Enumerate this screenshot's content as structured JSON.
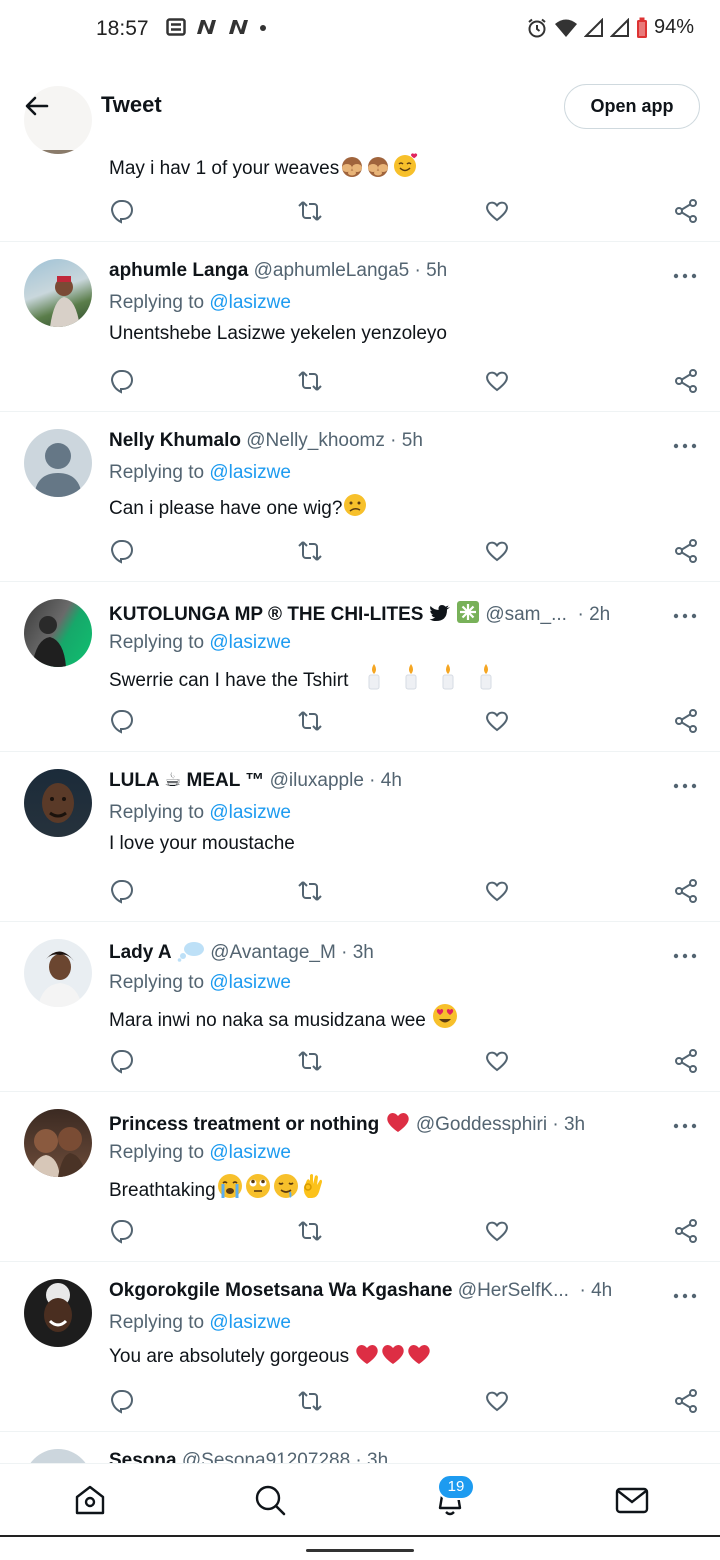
{
  "status_bar": {
    "time": "18:57",
    "battery_text": "94%",
    "notif_icons": [
      "news-icon",
      "n-app-icon",
      "n-app-icon",
      "dot"
    ]
  },
  "header": {
    "title": "Tweet",
    "open_app_label": "Open app"
  },
  "replying_to_prefix": "Replying to ",
  "partial_top": {
    "text": "May i hav 1 of your weaves"
  },
  "tweets": [
    {
      "name": "aphumle Langa",
      "handle": "@aphumleLanga5",
      "time": "5h",
      "replying_to": "@lasizwe",
      "text": "Unentshebe Lasizwe yekelen yenzoleyo"
    },
    {
      "name": "Nelly Khumalo",
      "handle": "@Nelly_khoomz",
      "time": "5h",
      "replying_to": "@lasizwe",
      "text": "Can i please have one wig?"
    },
    {
      "name": "KUTOLUNGA MP ® THE CHI-LITES",
      "handle": "@sam_...",
      "time": "2h",
      "replying_to": "@lasizwe",
      "text": "Swerrie can I have the Tshirt"
    },
    {
      "name": "LULA ☕ MEAL ™",
      "handle": "@iluxapple",
      "time": "4h",
      "replying_to": "@lasizwe",
      "text": "I love your moustache"
    },
    {
      "name": "Lady A",
      "handle": "@Avantage_M",
      "time": "3h",
      "replying_to": "@lasizwe",
      "text": "Mara inwi no naka sa musidzana wee"
    },
    {
      "name": "Princess treatment or nothing",
      "handle": "@Goddessphiri",
      "time": "3h",
      "replying_to": "@lasizwe",
      "text": "Breathtaking"
    },
    {
      "name": "Okgorokgile Mosetsana Wa Kgashane",
      "handle": "@HerSelfK...",
      "time": "4h",
      "replying_to": "@lasizwe",
      "text": "You are absolutely gorgeous"
    }
  ],
  "partial_bottom": {
    "name": "Sesona",
    "handle": "@Sesona91207288",
    "time": "3h"
  },
  "bottom_nav": {
    "items": [
      "home-icon",
      "search-icon",
      "notifications-icon",
      "messages-icon"
    ],
    "notification_badge": "19"
  },
  "colors": {
    "accent": "#1d9bf0",
    "text": "#0f1419",
    "secondary": "#536471",
    "divider": "#eff3f4"
  }
}
